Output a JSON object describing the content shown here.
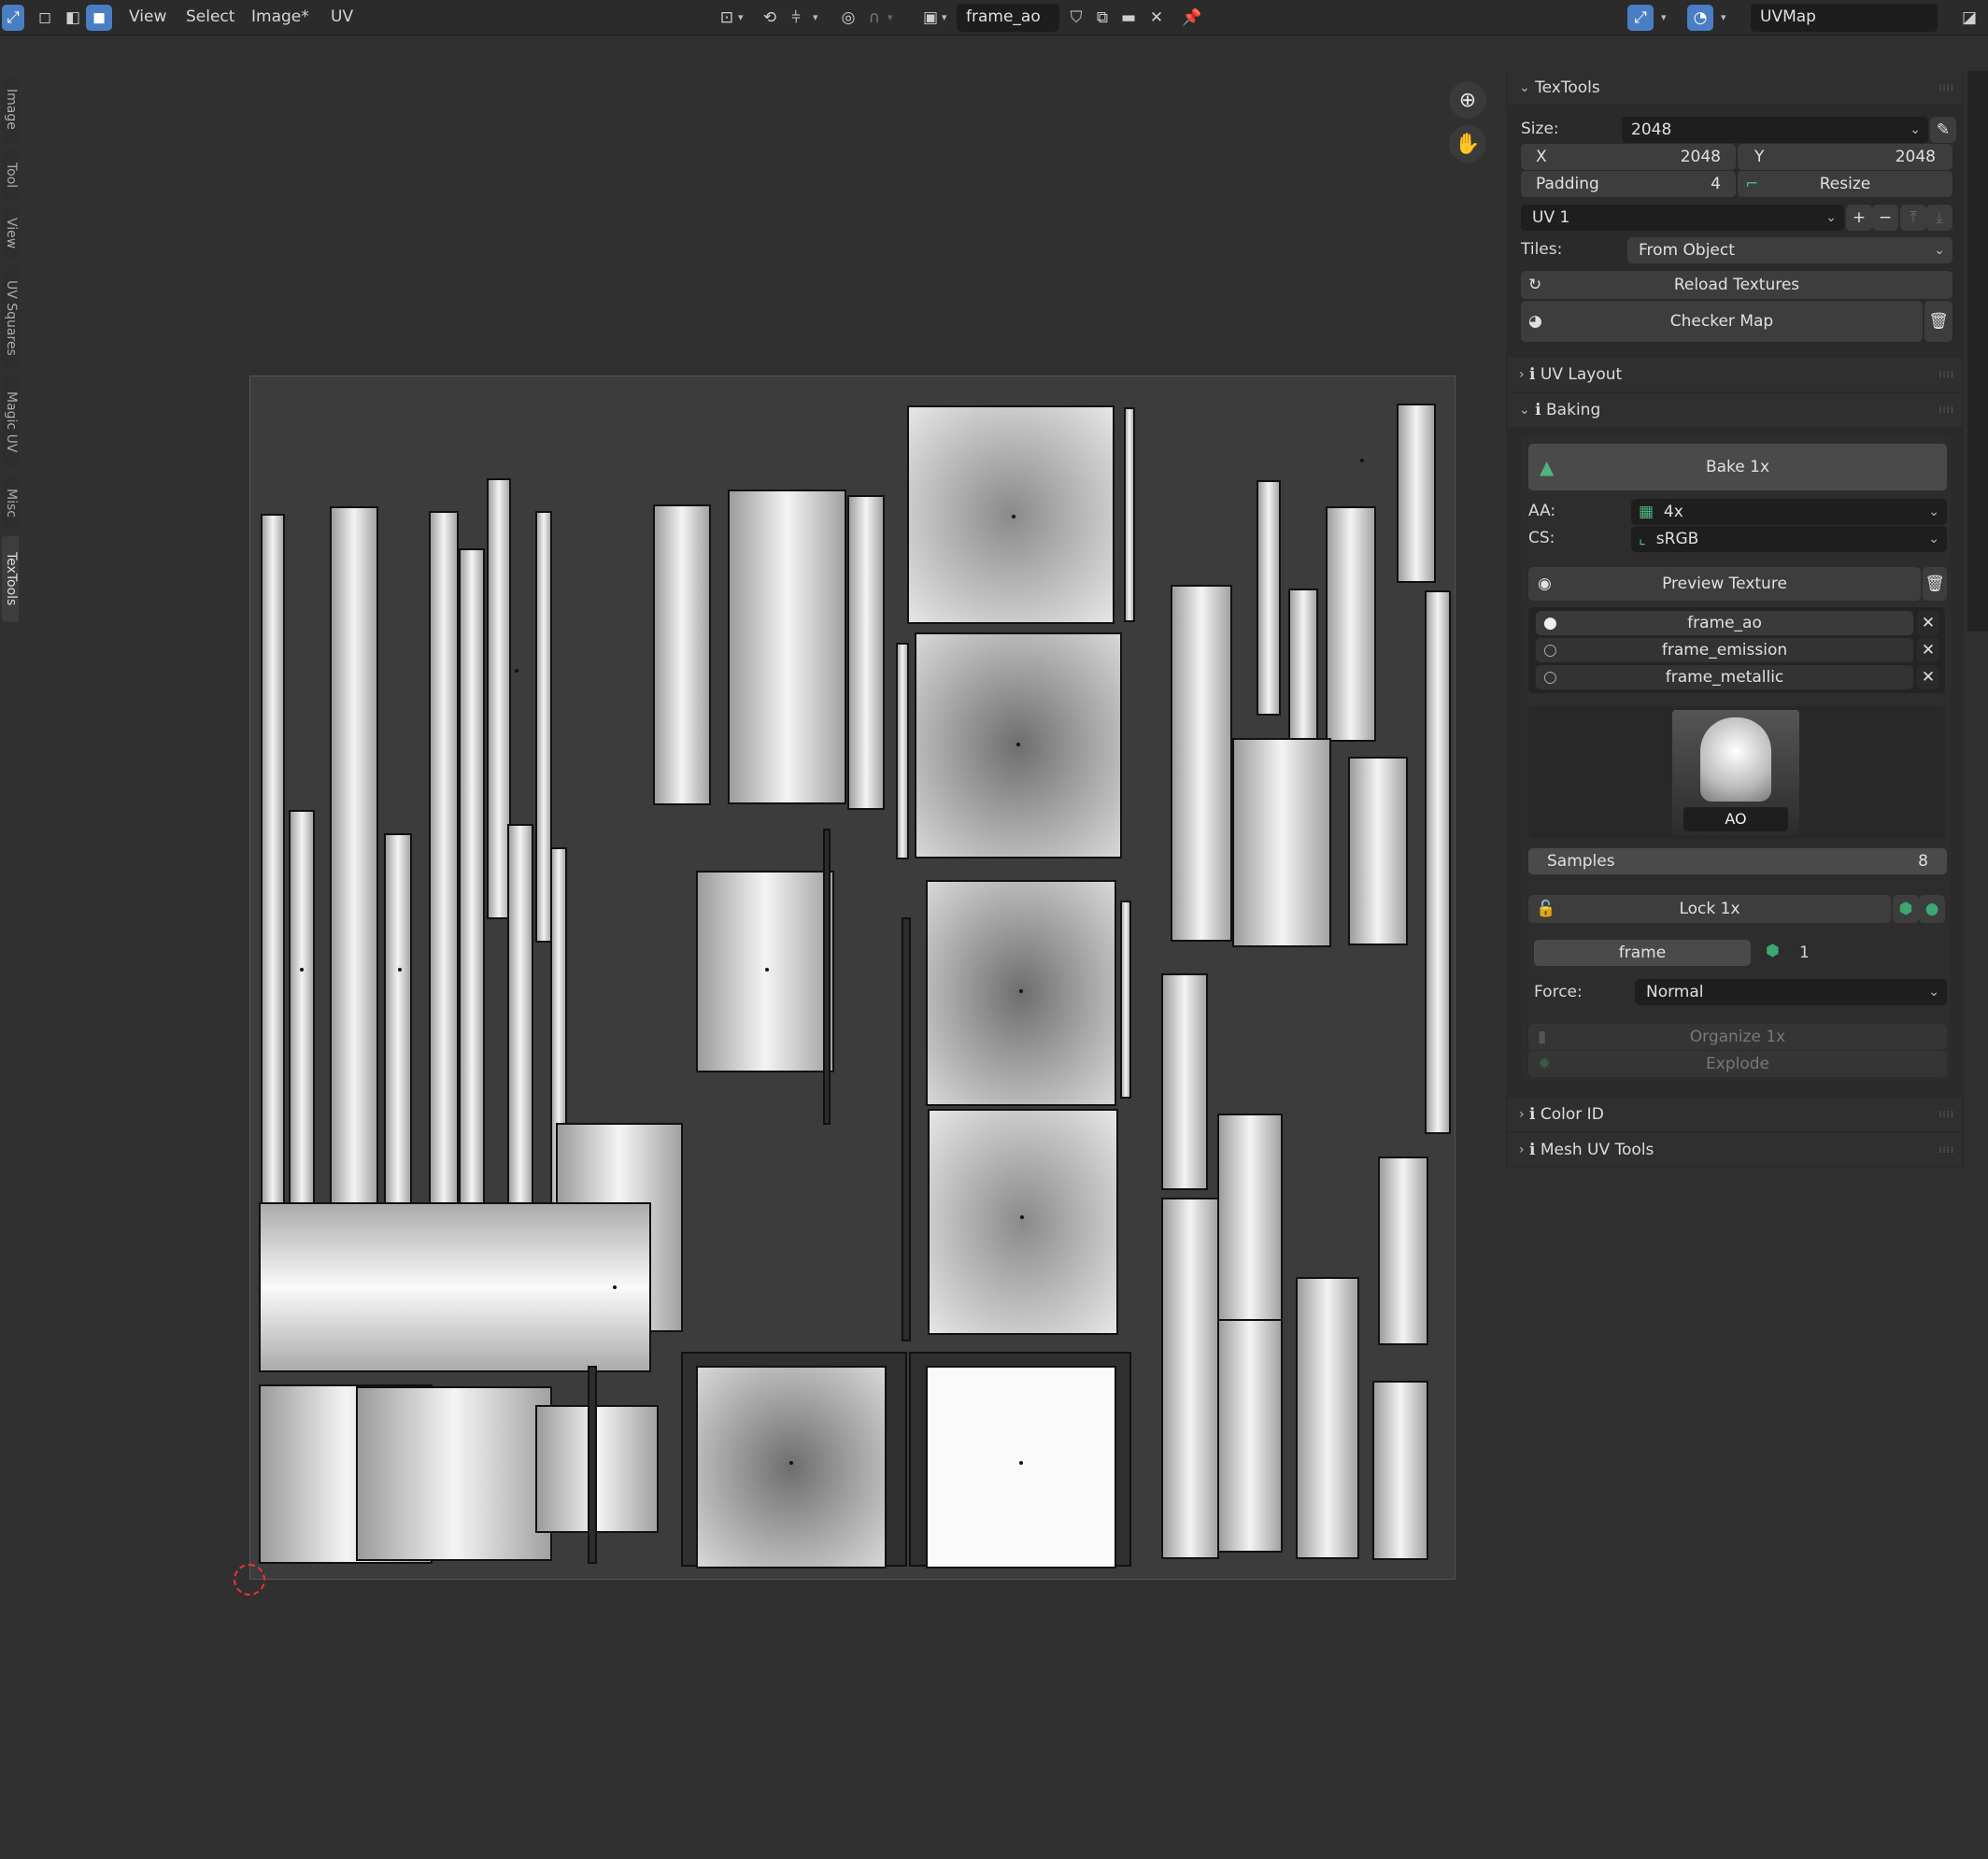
{
  "header": {
    "menus": [
      "View",
      "Select",
      "Image*",
      "UV"
    ],
    "image_name": "frame_ao",
    "uv_map": "UVMap"
  },
  "panel": {
    "textools": {
      "title": "TexTools",
      "size_label": "Size:",
      "size_value": "2048",
      "x_label": "X",
      "x_value": "2048",
      "y_label": "Y",
      "y_value": "2048",
      "padding_label": "Padding",
      "padding_value": "4",
      "resize_label": "Resize",
      "uv_channel": "UV 1",
      "tiles_label": "Tiles:",
      "tiles_value": "From Object",
      "reload_label": "Reload Textures",
      "checker_label": "Checker Map"
    },
    "uv_layout": {
      "title": "UV Layout"
    },
    "baking": {
      "title": "Baking",
      "bake_label": "Bake 1x",
      "aa_label": "AA:",
      "aa_value": "4x",
      "cs_label": "CS:",
      "cs_value": "sRGB",
      "preview_label": "Preview Texture",
      "textures": [
        {
          "name": "frame_ao",
          "selected": true
        },
        {
          "name": "frame_emission",
          "selected": false
        },
        {
          "name": "frame_metallic",
          "selected": false
        }
      ],
      "thumb_label": "AO",
      "samples_label": "Samples",
      "samples_value": "8",
      "lock_label": "Lock 1x",
      "object_name": "frame",
      "object_count": "1",
      "force_label": "Force:",
      "force_value": "Normal",
      "organize_label": "Organize 1x",
      "explode_label": "Explode"
    },
    "color_id": {
      "title": "Color ID"
    },
    "mesh_uv_tools": {
      "title": "Mesh UV Tools"
    }
  },
  "side_tabs": [
    "Image",
    "Tool",
    "View",
    "UV Squares",
    "Magic UV",
    "Misc",
    "TexTools"
  ],
  "colors": {
    "accent": "#4a7ec4",
    "bake_icon": "#4fb580",
    "object_icon": "#3aa870"
  }
}
